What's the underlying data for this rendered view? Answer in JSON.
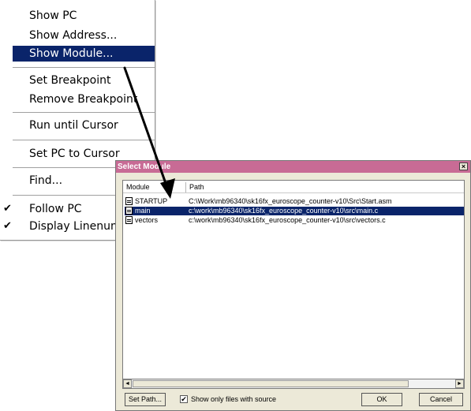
{
  "context_menu": {
    "items": [
      {
        "label": "Show PC"
      },
      {
        "label": "Show Address..."
      },
      {
        "label": "Show Module..."
      },
      {
        "label": "Set Breakpoint"
      },
      {
        "label": "Remove Breakpoint"
      },
      {
        "label": "Run until Cursor"
      },
      {
        "label": "Set PC to Cursor"
      },
      {
        "label": "Find..."
      },
      {
        "label": "Follow PC",
        "checked": true
      },
      {
        "label": "Display Linenumbers",
        "checked": true
      }
    ],
    "checkmark": "✔"
  },
  "dialog": {
    "title": "Select Module",
    "close_glyph": "×",
    "columns": {
      "module": "Module",
      "path": "Path"
    },
    "rows": [
      {
        "module": "STARTUP",
        "path": "C:\\Work\\mb96340\\sk16fx_euroscope_counter-v10\\Src\\Start.asm"
      },
      {
        "module": "main",
        "path": "c:\\work\\mb96340\\sk16fx_euroscope_counter-v10\\src\\main.c"
      },
      {
        "module": "vectors",
        "path": "c:\\work\\mb96340\\sk16fx_euroscope_counter-v10\\src\\vectors.c"
      }
    ],
    "selected_row": "main",
    "scroll_left": "◄",
    "scroll_right": "►",
    "buttons": {
      "set_path": "Set Path...",
      "ok": "OK",
      "cancel": "Cancel"
    },
    "show_only_source": {
      "label": "Show only files with source",
      "checked": true,
      "glyph": "✔"
    }
  },
  "annotation": {
    "arrow_color": "#000000"
  }
}
